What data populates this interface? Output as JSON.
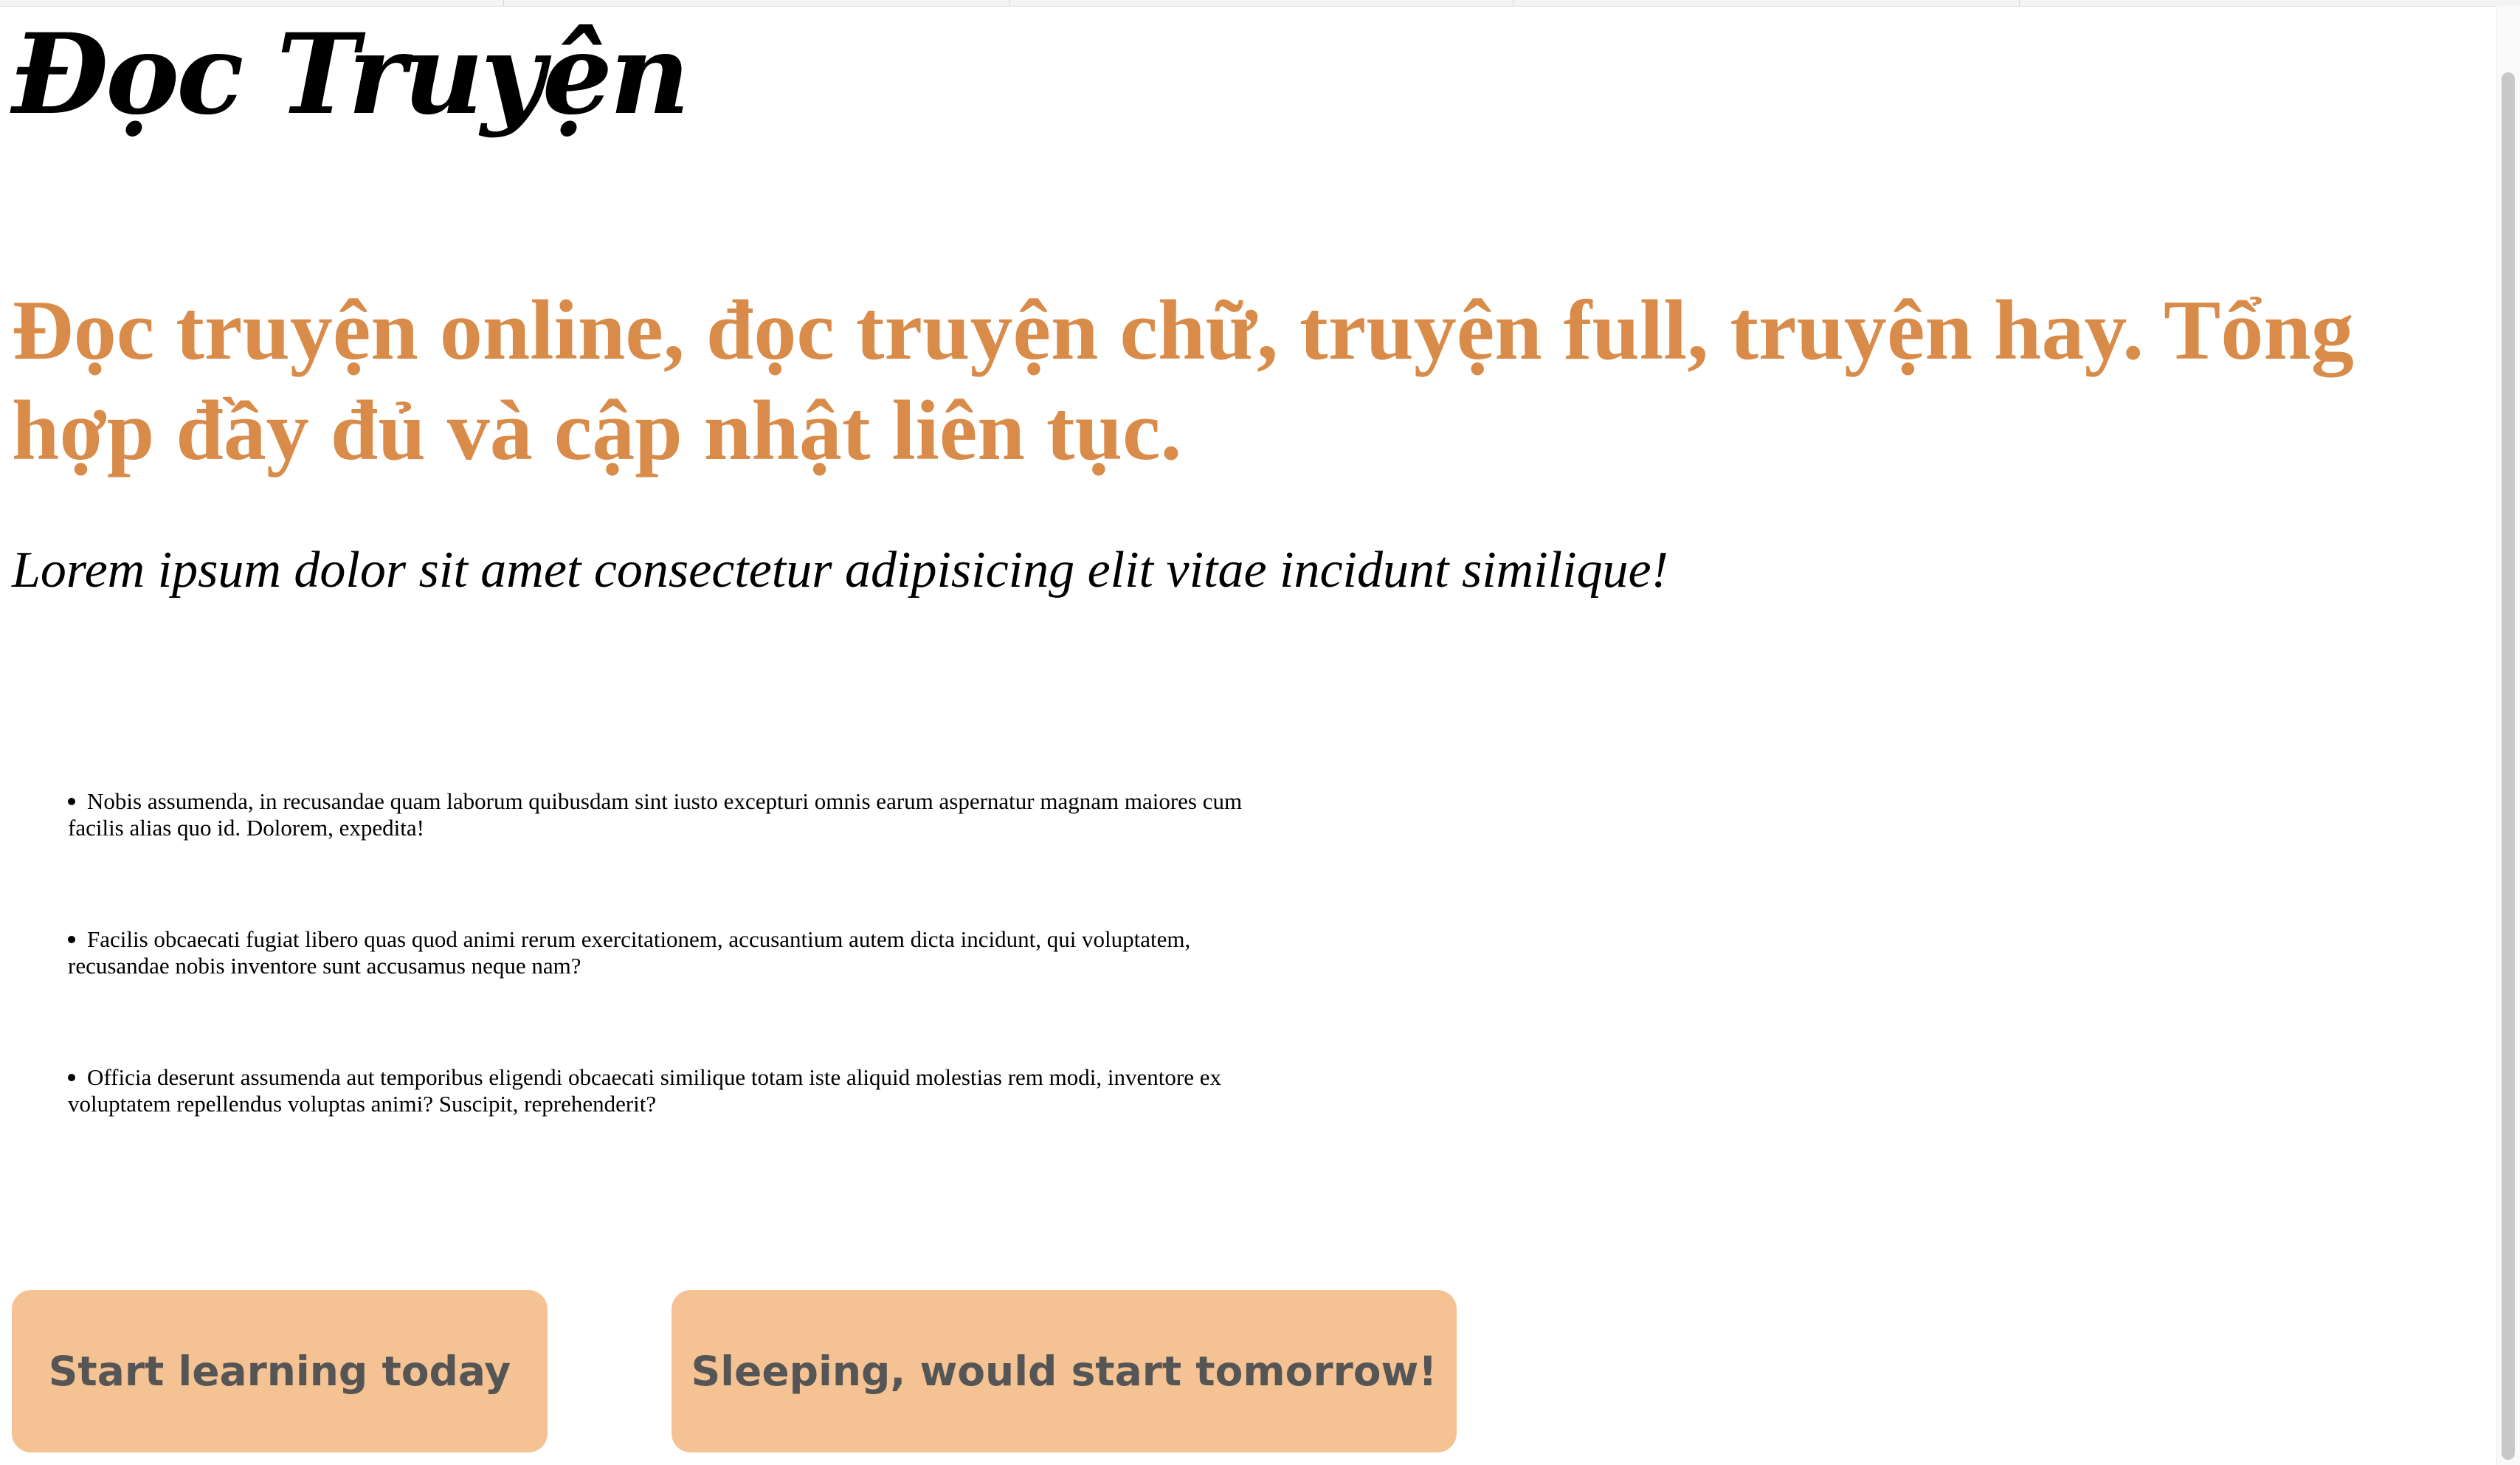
{
  "header": {
    "logo_text": "Đọc Truyện"
  },
  "hero": {
    "headline": "Đọc truyện online, đọc truyện chữ, truyện full, truyện hay. Tổng hợp đầy đủ và cập nhật liên tục.",
    "subtitle": "Lorem ipsum dolor sit amet consectetur adipisicing elit vitae incidunt similique!"
  },
  "features": {
    "items": [
      "Nobis assumenda, in recusandae quam laborum quibusdam sint iusto excepturi omnis earum aspernatur magnam maiores cum facilis alias quo id. Dolorem, expedita!",
      "Facilis obcaecati fugiat libero quas quod animi rerum exercitationem, accusantium autem dicta incidunt, qui voluptatem, recusandae nobis inventore sunt accusamus neque nam?",
      "Officia deserunt assumenda aut temporibus eligendi obcaecati similique totam iste aliquid molestias rem modi, inventore ex voluptatem repellendus voluptas animi? Suscipit, reprehenderit?"
    ]
  },
  "actions": {
    "start_label": "Start learning today",
    "sleep_label": "Sleeping, would start tomorrow!"
  },
  "colors": {
    "headline": "#d98c4a",
    "button_bg": "#f4c293",
    "button_text": "#555555"
  }
}
